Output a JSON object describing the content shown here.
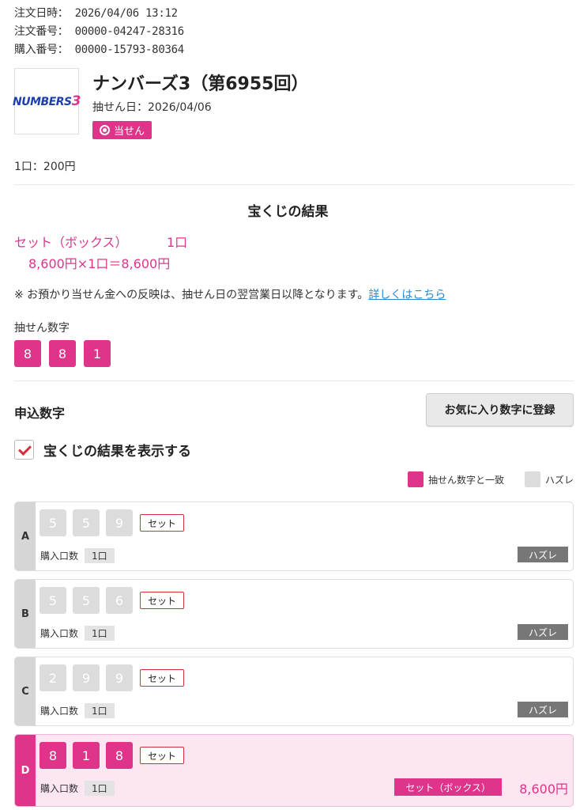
{
  "order": {
    "date_label": "注文日時：",
    "date_value": "2026/04/06 13:12",
    "order_no_label": "注文番号：",
    "order_no_value": "00000-04247-28316",
    "purchase_no_label": "購入番号：",
    "purchase_no_value": "00000-15793-80364"
  },
  "lottery": {
    "logo_text": "NUMBERS",
    "logo_digit": "3",
    "title": "ナンバーズ3（第6955回）",
    "draw_date": "抽せん日：2026/04/06",
    "status_badge": "当せん",
    "unit_price": "1口：200円"
  },
  "results": {
    "section_title": "宝くじの結果",
    "win_type": "セット（ボックス）",
    "win_units": "1口",
    "calc": "8,600円×1口＝8,600円",
    "note": "※ お預かり当せん金への反映は、抽せん日の翌営業日以降となります。",
    "note_link": "詳しくはこちら",
    "winning_label": "抽せん数字",
    "winning_numbers": [
      "8",
      "8",
      "1"
    ]
  },
  "application": {
    "title": "申込数字",
    "favorite_button": "お気に入り数字に登録",
    "show_results_label": "宝くじの結果を表示する",
    "legend": {
      "match": "抽せん数字と一致",
      "miss": "ハズレ"
    },
    "qty_label": "購入口数",
    "entries": [
      {
        "letter": "A",
        "numbers": [
          "5",
          "5",
          "9"
        ],
        "type": "セット",
        "qty": "1口",
        "result": "ハズレ",
        "amount": ""
      },
      {
        "letter": "B",
        "numbers": [
          "5",
          "5",
          "6"
        ],
        "type": "セット",
        "qty": "1口",
        "result": "ハズレ",
        "amount": ""
      },
      {
        "letter": "C",
        "numbers": [
          "2",
          "9",
          "9"
        ],
        "type": "セット",
        "qty": "1口",
        "result": "ハズレ",
        "amount": ""
      },
      {
        "letter": "D",
        "numbers": [
          "8",
          "1",
          "8"
        ],
        "type": "セット",
        "qty": "1口",
        "result": "セット（ボックス）",
        "amount": "8,600円"
      }
    ]
  },
  "colors": {
    "accent": "#e0338a",
    "miss": "#dcdcdc",
    "link": "#2a8ad0"
  }
}
